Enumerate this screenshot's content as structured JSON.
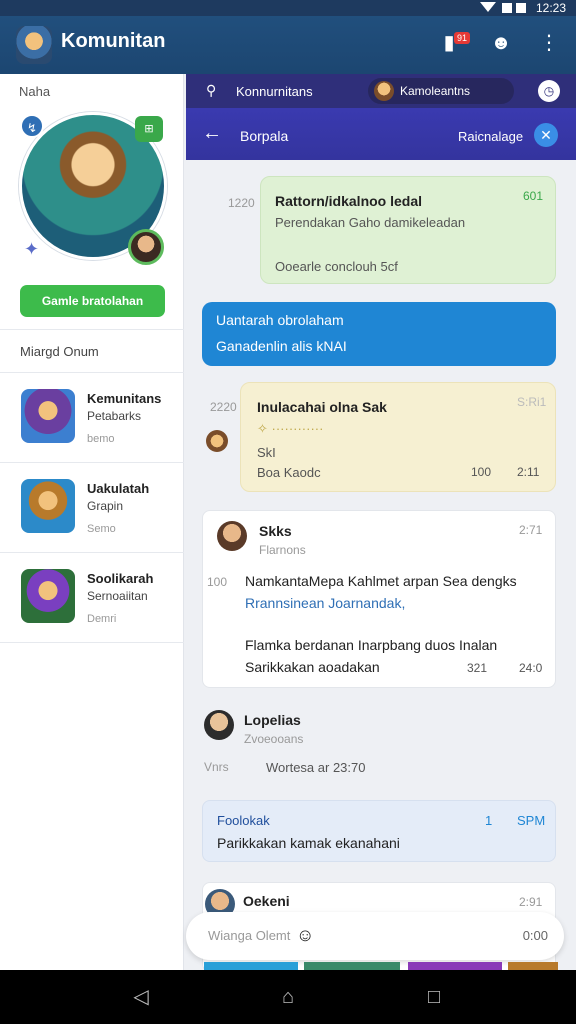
{
  "status": {
    "time": "12:23"
  },
  "appbar": {
    "title": "Komunitan",
    "chat_badge": "91"
  },
  "sidebar": {
    "label": "Naha",
    "hero_badge": "↯",
    "game_button": "Gamle bratolahan",
    "section_title": "Miargd Onum",
    "games": [
      {
        "name": "Kemunitans",
        "sub": "Petabarks",
        "meta": "bemo"
      },
      {
        "name": "Uakulatah",
        "sub": "Grapin",
        "meta": "Semo"
      },
      {
        "name": "Soolikarah",
        "sub": "Sernoaiitan",
        "meta": "Demri"
      }
    ]
  },
  "topstrip": {
    "label": "Konnurnitans",
    "pill": "Kamoleantns"
  },
  "chatheader": {
    "title": "Borpala",
    "right": "Raicnalage"
  },
  "messages": {
    "m1": {
      "time": "1220",
      "title": "Rattorn/idkalnoo ledal",
      "sub": "Perendakan Gaho damikeleadan",
      "foot": "Ooearle conclouh 5cf",
      "count": "601"
    },
    "m2": {
      "title": "Uantarah obrolaham",
      "sub": "Ganadenlin alis kNAI"
    },
    "m3": {
      "time": "2220",
      "title": "Inulacahai olna Sak",
      "sub": "SkI",
      "foot": "Boa Kaodc",
      "likes": "100",
      "tm": "2:11",
      "count": "S:Ri1"
    },
    "m4": {
      "name": "Skks",
      "role": "Flarnons",
      "time": "2:71",
      "num": "100",
      "l1": "NamkantaMepa Kahlmet arpan Sea dengks",
      "l2": "Rrannsinean Joarnandak,",
      "l3": "Flamka berdanan Inarpbang duos Inalan",
      "l4": "Sarikkakan aoadakan",
      "likes": "321",
      "tm": "24:0"
    },
    "m5": {
      "name": "Lopelias",
      "role": "Zvoeooans",
      "foot_a": "Vnrs",
      "foot_b": "Wortesa ar 23:70"
    },
    "m6": {
      "title": "Foolokak",
      "sub": "Parikkakan kamak ekanahani",
      "meta_a": "1",
      "meta_b": "SPM"
    },
    "m7": {
      "name": "Oekeni",
      "time": "2:91"
    }
  },
  "input": {
    "placeholder": "Wianga Olemt",
    "count": "0:00"
  },
  "colors": {
    "accent_green": "#3dbb4b",
    "header_purple": "#3838a6",
    "blue": "#1f86d4"
  }
}
